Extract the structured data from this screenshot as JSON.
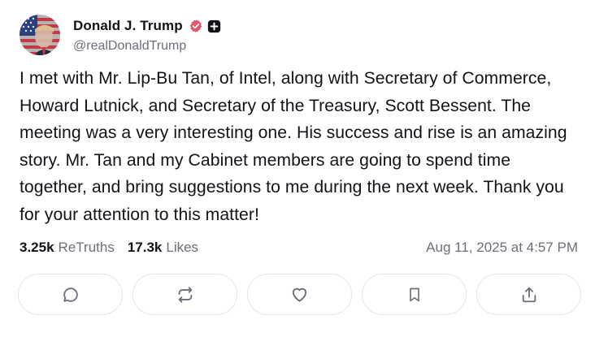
{
  "post": {
    "author": {
      "display_name": "Donald J. Trump",
      "handle": "@realDonaldTrump",
      "verified_color": "#e4566a",
      "badge_icon": "plus-square-icon"
    },
    "text": "I met with Mr. Lip-Bu Tan, of Intel, along with Secretary of Commerce, Howard Lutnick, and Secretary of the Treasury, Scott Bessent. The meeting was a very interesting one. His success and rise is an amazing story. Mr. Tan and my Cabinet members are going to spend time together, and bring suggestions to me during the next week. Thank you for your attention to this matter!",
    "stats": {
      "retruths_count": "3.25k",
      "retruths_label": "ReTruths",
      "likes_count": "17.3k",
      "likes_label": "Likes"
    },
    "timestamp": "Aug 11, 2025 at 4:57 PM",
    "actions": [
      {
        "icon": "reply-icon"
      },
      {
        "icon": "retruth-icon"
      },
      {
        "icon": "like-heart-icon"
      },
      {
        "icon": "bookmark-icon"
      },
      {
        "icon": "share-icon"
      }
    ]
  }
}
